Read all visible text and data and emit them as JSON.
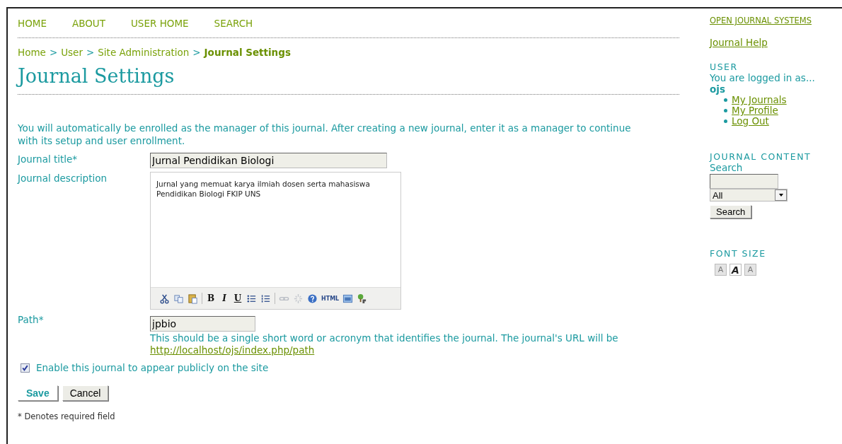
{
  "nav": [
    "HOME",
    "ABOUT",
    "USER HOME",
    "SEARCH"
  ],
  "breadcrumb": [
    {
      "label": "Home",
      "current": false
    },
    {
      "label": "User",
      "current": false
    },
    {
      "label": "Site Administration",
      "current": false
    },
    {
      "label": "Journal Settings",
      "current": true
    }
  ],
  "breadcrumb_separator": ">",
  "page_title": "Journal Settings",
  "intro": "You will automatically be enrolled as the manager of this journal. After creating a new journal, enter it as a manager to continue with its setup and user enrollment.",
  "form": {
    "title_label": "Journal title*",
    "title_value": "Jurnal Pendidikan Biologi",
    "description_label": "Journal description",
    "description_value": "Jurnal yang memuat karya ilmiah dosen serta mahasiswa Pendidikan Biologi FKIP UNS",
    "toolbar": [
      {
        "kind": "cut"
      },
      {
        "kind": "copy"
      },
      {
        "kind": "paste"
      },
      {
        "kind": "separator"
      },
      {
        "kind": "bold",
        "label": "B"
      },
      {
        "kind": "italic",
        "label": "I"
      },
      {
        "kind": "underline",
        "label": "U"
      },
      {
        "kind": "bullets"
      },
      {
        "kind": "numbers"
      },
      {
        "kind": "separator"
      },
      {
        "kind": "link"
      },
      {
        "kind": "unlink"
      },
      {
        "kind": "help"
      },
      {
        "kind": "html",
        "label": "HTML"
      },
      {
        "kind": "image"
      },
      {
        "kind": "plugin"
      }
    ],
    "path_label": "Path*",
    "path_value": "jpbio",
    "path_hint": "This should be a single short word or acronym that identifies the journal. The journal's URL will be",
    "path_url": "http://localhost/ojs/index.php/path",
    "public_label": "Enable this journal to appear publicly on the site",
    "public_checked": true,
    "buttons": [
      {
        "label": "Save",
        "kind": "primary"
      },
      {
        "label": "Cancel",
        "kind": "secondary"
      }
    ],
    "footnote": "* Denotes required field"
  },
  "sidebar": {
    "brand": "OPEN JOURNAL SYSTEMS",
    "help": "Journal Help",
    "user_heading": "USER",
    "logged_in": "You are logged in as...",
    "username": "ojs",
    "user_links": [
      "My Journals",
      "My Profile",
      "Log Out"
    ],
    "content_heading": "JOURNAL CONTENT",
    "search_label": "Search",
    "search_scope": "All",
    "search_button": "Search",
    "font_heading": "FONT SIZE",
    "font_sizes": [
      {
        "kind": "small",
        "label": "A"
      },
      {
        "kind": "default",
        "label": "A"
      },
      {
        "kind": "large",
        "label": "A"
      }
    ]
  }
}
